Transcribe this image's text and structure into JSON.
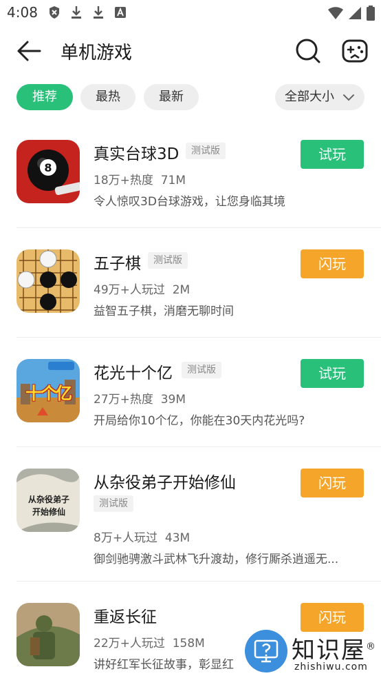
{
  "status_bar": {
    "time": "4:08",
    "left_icons": [
      "shield-icon",
      "download-icon",
      "download-icon",
      "font-a-icon"
    ],
    "right_icons": [
      "wifi-icon",
      "signal-icon",
      "battery-icon"
    ]
  },
  "toolbar": {
    "title": "单机游戏",
    "back_icon": "arrow-left-icon",
    "search_icon": "search-icon",
    "game_icon": "gamepad-icon"
  },
  "filters": {
    "tabs": [
      {
        "label": "推荐",
        "active": true
      },
      {
        "label": "最热",
        "active": false
      },
      {
        "label": "最新",
        "active": false
      }
    ],
    "size_select": {
      "label": "全部大小",
      "icon": "chevron-down-icon"
    }
  },
  "games": [
    {
      "name": "真实台球3D",
      "badge": "测试版",
      "popularity": "18万+热度",
      "size": "71M",
      "description": "令人惊叹3D台球游戏，让您身临其境",
      "button": "试玩",
      "button_color": "#29c07a"
    },
    {
      "name": "五子棋",
      "badge": "测试版",
      "popularity": "49万+人玩过",
      "size": "2M",
      "description": "益智五子棋，消磨无聊时间",
      "button": "闪玩",
      "button_color": "#f5a52a"
    },
    {
      "name": "花光十个亿",
      "badge": "测试版",
      "popularity": "27万+热度",
      "size": "39M",
      "description": "开局给你10个亿，你能在30天内花光吗?",
      "button": "试玩",
      "button_color": "#29c07a",
      "icon_text": "十个亿"
    },
    {
      "name": "从杂役弟子开始修仙",
      "badge": "测试版",
      "popularity": "8万+人玩过",
      "size": "43M",
      "description": "御剑驰骋激斗武林飞升渡劫，修行厮杀逍遥无...",
      "button": "闪玩",
      "button_color": "#f5a52a",
      "icon_text_1": "从杂役弟子",
      "icon_text_2": "开始修仙"
    },
    {
      "name": "重返长征",
      "badge": "",
      "popularity": "22万+人玩过",
      "size": "158M",
      "description": "讲好红军长征故事，彰显红",
      "button": "闪玩",
      "button_color": "#f5a52a"
    }
  ],
  "watermark": {
    "title": "知识屋",
    "registered": "®",
    "url": "zhishiwu.com",
    "icon": "question-monitor-icon"
  }
}
